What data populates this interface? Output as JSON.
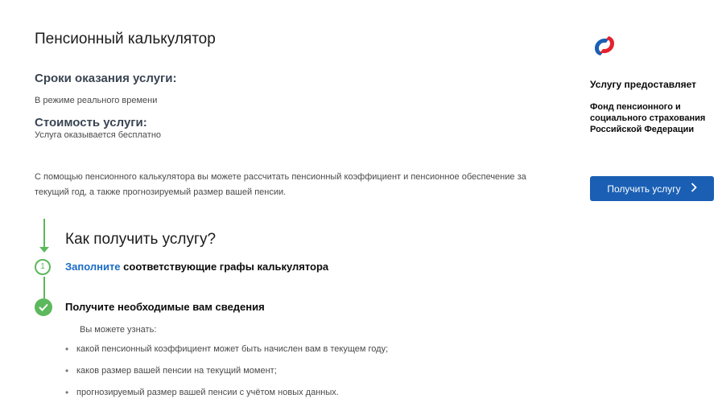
{
  "page": {
    "title": "Пенсионный калькулятор"
  },
  "terms": {
    "heading": "Сроки оказания услуги:",
    "value": "В режиме реального времени"
  },
  "cost": {
    "heading": "Стоимость услуги:",
    "value": "Услуга оказывается бесплатно"
  },
  "description": "С помощью пенсионного калькулятора вы можете рассчитать пенсионный коэффициент и пенсионное обеспечение за текущий год, а также прогнозируемый размер вашей пенсии.",
  "provider": {
    "label": "Услугу предоставляет",
    "name": "Фонд пенсионного и социального страхования Российской Федерации",
    "logo_icon": "sfr-logo-icon",
    "logo_colors": [
      "#1a5fb4",
      "#e4222d"
    ]
  },
  "action": {
    "button_label": "Получить услугу",
    "button_icon": "chevron-right-icon",
    "button_color": "#1a5fb4"
  },
  "how": {
    "title": "Как получить услугу?",
    "accent_color": "#5cb85c",
    "steps": [
      {
        "number": "1",
        "link_text": "Заполните",
        "rest_text": " соответствующие графы калькулятора"
      },
      {
        "icon": "check-icon",
        "text": "Получите необходимые вам сведения"
      }
    ],
    "you_can_label": "Вы можете узнать:",
    "bullets": [
      "какой пенсионный коэффициент может быть начислен вам в текущем году;",
      "каков размер вашей пенсии на текущий момент;",
      "прогнозируемый размер вашей пенсии с учётом новых данных."
    ]
  }
}
